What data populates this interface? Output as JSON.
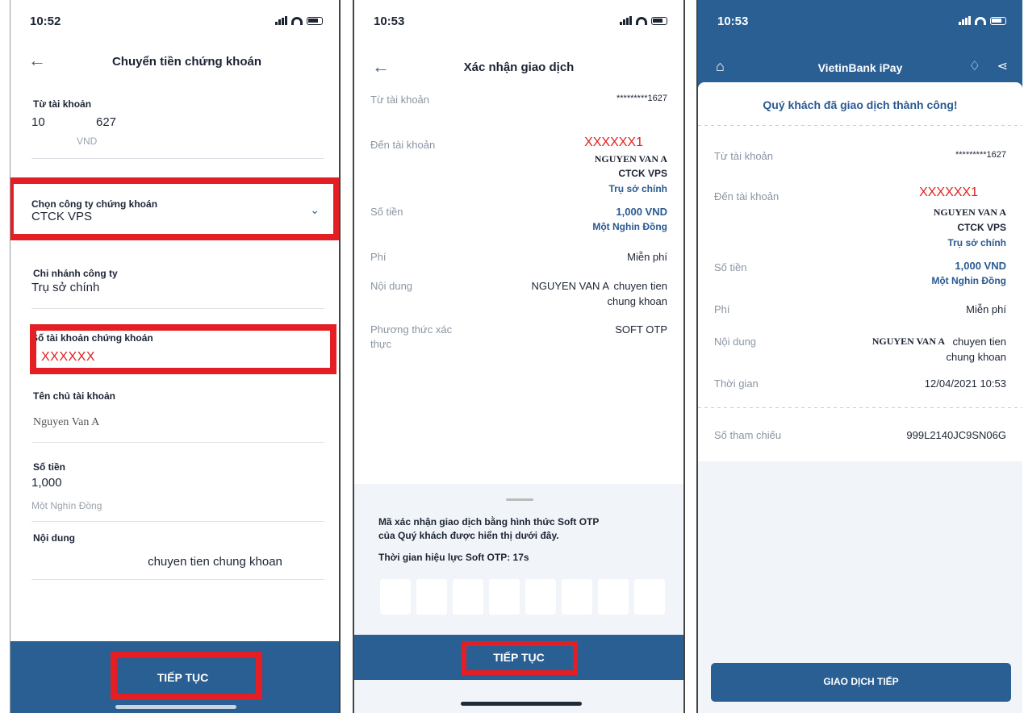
{
  "screen1": {
    "time": "10:52",
    "title": "Chuyển tiền chứng khoán",
    "from_label": "Từ tài khoản",
    "from_num_a": "10",
    "from_num_b": "627",
    "from_currency": "VND",
    "company_label": "Chọn công ty chứng khoán",
    "company_value": "CTCK VPS",
    "branch_label": "Chi nhánh công ty",
    "branch_value": "Trụ sở chính",
    "account_label": "Số tài khoản chứng khoán",
    "account_value": "XXXXXX",
    "owner_label": "Tên chủ tài khoản",
    "owner_value": "Nguyen Van A",
    "amount_label": "Số tiền",
    "amount_value": "1,000",
    "amount_words": "Một Nghìn Đồng",
    "content_label": "Nội dung",
    "content_value": "chuyen tien chung khoan",
    "continue_label": "TIẾP TỤC"
  },
  "screen2": {
    "time": "10:53",
    "title": "Xác nhận giao dịch",
    "from_label": "Từ tài khoản",
    "from_value": "*********1627",
    "to_label": "Đến tài khoản",
    "to_account": "XXXXXX1",
    "to_name": "NGUYEN VAN A",
    "to_company": "CTCK VPS",
    "to_branch": "Trụ sở chính",
    "amount_label": "Số tiền",
    "amount_value": "1,000 VND",
    "amount_words": "Một Nghin Đồng",
    "fee_label": "Phí",
    "fee_value": "Miễn phí",
    "content_label": "Nội dung",
    "content_name": "NGUYEN VAN A",
    "content_line1": "chuyen tien",
    "content_line2": "chung khoan",
    "method_label_1": "Phương thức xác",
    "method_label_2": "thực",
    "method_value": "SOFT OTP",
    "otp_text_1": "Mã xác nhận giao dịch bằng hình thức Soft OTP",
    "otp_text_2": "của Quý khách được hiển thị dưới đây.",
    "otp_timer": "Thời gian hiệu lực Soft OTP:  17s",
    "continue_label": "TIẾP TỤC"
  },
  "screen3": {
    "time": "10:53",
    "app_title": "VietinBank iPay",
    "success_message": "Quý khách đã giao dịch thành công!",
    "from_label": "Từ tài khoản",
    "from_value": "*********1627",
    "to_label": "Đến tài khoản",
    "to_account": "XXXXXX1",
    "to_name": "NGUYEN VAN A",
    "to_company": "CTCK VPS",
    "to_branch": "Trụ sở chính",
    "amount_label": "Số tiền",
    "amount_value": "1,000 VND",
    "amount_words": "Một Nghin Đồng",
    "fee_label": "Phí",
    "fee_value": "Miễn phí",
    "content_label": "Nội dung",
    "content_name": "NGUYEN VAN A",
    "content_line1": "chuyen tien",
    "content_line2": "chung khoan",
    "time_label": "Thời gian",
    "time_value": "12/04/2021 10:53",
    "ref_label": "Số tham chiếu",
    "ref_value": "999L2140JC9SN06G",
    "next_label": "GIAO DỊCH TIẾP"
  },
  "colors": {
    "brand_blue": "#295f93",
    "highlight_red": "#e31e24",
    "value_blue": "#2a5a92"
  },
  "icons": [
    "back-arrow-icon",
    "chevron-down-icon",
    "home-icon",
    "notification-icon",
    "share-icon",
    "signal-icon",
    "wifi-icon",
    "battery-icon",
    "location-arrow-icon"
  ]
}
